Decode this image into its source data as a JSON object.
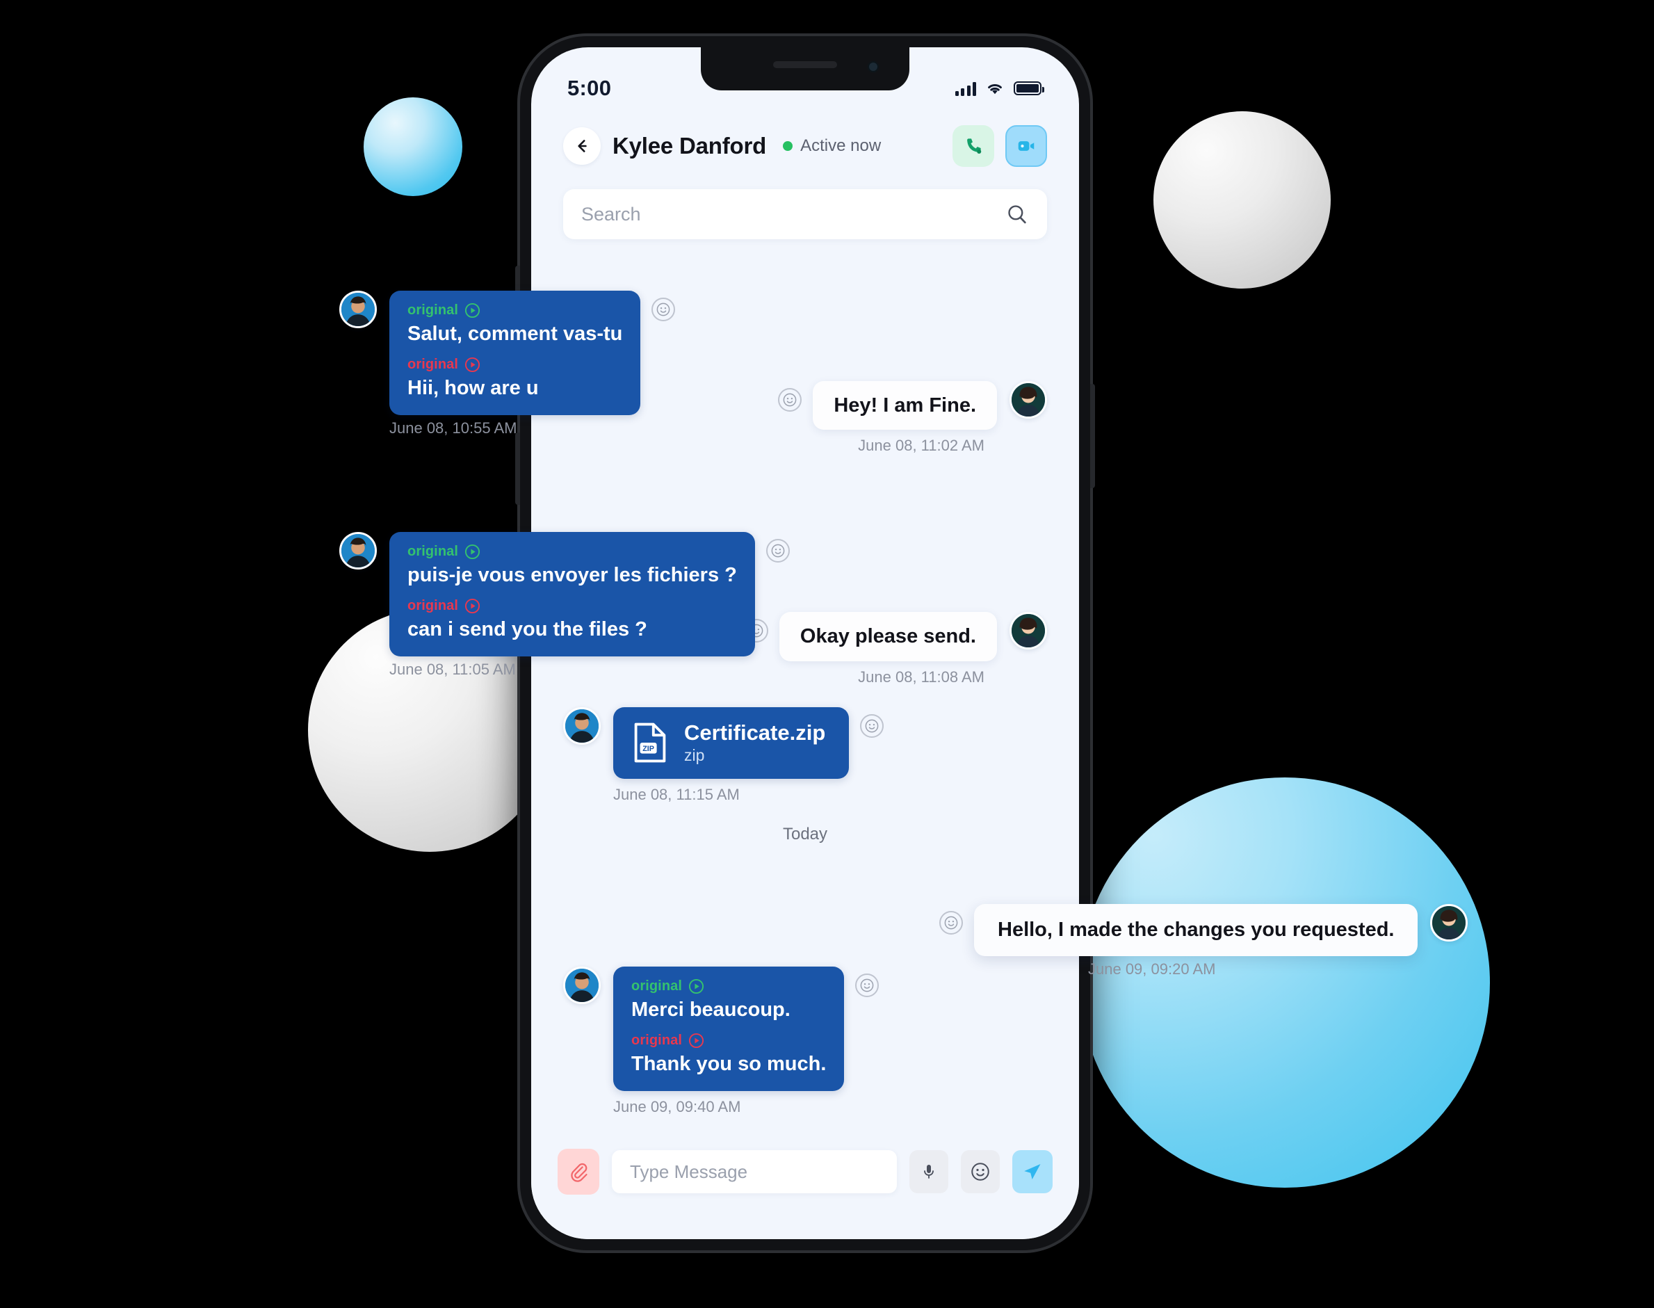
{
  "status_bar": {
    "time": "5:00",
    "icons": [
      "signal-bars-icon",
      "wifi-icon",
      "battery-icon"
    ]
  },
  "header": {
    "back_icon": "arrow-left-icon",
    "peer_name": "Kylee Danford",
    "presence": "Active now",
    "presence_color": "#27c062",
    "call_icon": "phone-icon",
    "video_icon": "video-camera-icon"
  },
  "search": {
    "placeholder": "Search",
    "value": "",
    "icon": "search-icon"
  },
  "colors": {
    "incoming_bubble": "#1a55a8",
    "outgoing_bubble": "#fdfdfe",
    "original_green": "#34c26e",
    "original_red": "#e8384f",
    "accent_blue": "#a8e1fb",
    "screen_bg": "#f2f6fd"
  },
  "messages": [
    {
      "id": "m1",
      "direction": "in",
      "type": "translated",
      "original_label": "original",
      "original_text": "Salut, comment vas-tu",
      "translated_label": "original",
      "translated_text": "Hii, how are u",
      "timestamp": "June 08, 10:55 AM",
      "popped_out": true
    },
    {
      "id": "m2",
      "direction": "out",
      "type": "text",
      "text": "Hey! I am Fine.",
      "timestamp": "June 08, 11:02 AM",
      "popped_out": false
    },
    {
      "id": "m3",
      "direction": "in",
      "type": "translated",
      "original_label": "original",
      "original_text": "puis-je vous envoyer les fichiers ?",
      "translated_label": "original",
      "translated_text": "can i send you the files ?",
      "timestamp": "June 08, 11:05 AM",
      "popped_out": true
    },
    {
      "id": "m4",
      "direction": "out",
      "type": "text",
      "text": "Okay please send.",
      "timestamp": "June 08, 11:08 AM",
      "popped_out": false
    },
    {
      "id": "m5",
      "direction": "in",
      "type": "file",
      "file_name": "Certificate.zip",
      "file_type": "zip",
      "file_icon": "zip-file-icon",
      "timestamp": "June 08, 11:15 AM",
      "popped_out": false
    },
    {
      "id": "sep1",
      "type": "day_separator",
      "label": "Today"
    },
    {
      "id": "m6",
      "direction": "out",
      "type": "text",
      "text": "Hello, I made the changes\nyou requested.",
      "timestamp": "June 09, 09:20 AM",
      "popped_out": true
    },
    {
      "id": "m7",
      "direction": "in",
      "type": "translated",
      "original_label": "original",
      "original_text": "Merci beaucoup.",
      "translated_label": "original",
      "translated_text": "Thank you so much.",
      "timestamp": "June 09, 09:40 AM",
      "popped_out": false
    }
  ],
  "composer": {
    "attach_icon": "paperclip-icon",
    "placeholder": "Type Message",
    "value": "",
    "mic_icon": "microphone-icon",
    "emoji_icon": "smiley-icon",
    "send_icon": "send-paper-plane-icon"
  }
}
